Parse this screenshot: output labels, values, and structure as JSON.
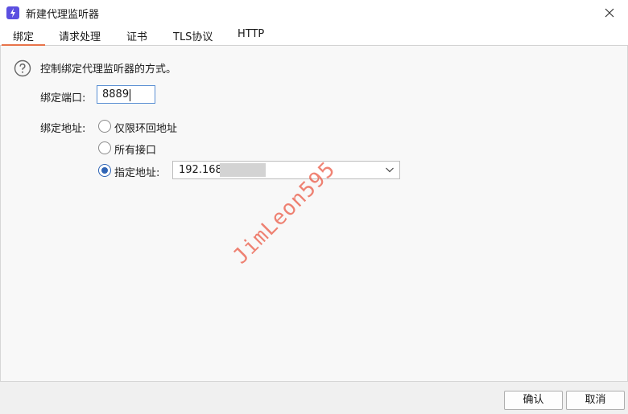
{
  "window": {
    "title": "新建代理监听器",
    "icon": "lightning-icon",
    "close_icon": "close-icon"
  },
  "tabs": [
    {
      "label": "绑定",
      "active": true
    },
    {
      "label": "请求处理",
      "active": false
    },
    {
      "label": "证书",
      "active": false
    },
    {
      "label": "TLS协议",
      "active": false
    },
    {
      "label": "HTTP",
      "active": false
    }
  ],
  "bind": {
    "description": "控制绑定代理监听器的方式。",
    "port_label": "绑定端口:",
    "port_value": "8889",
    "address_label": "绑定地址:",
    "options": [
      {
        "label": "仅限环回地址",
        "checked": false
      },
      {
        "label": "所有接口",
        "checked": false
      },
      {
        "label": "指定地址:",
        "checked": true
      }
    ],
    "address_value": "192.168"
  },
  "watermark": "JimLeon595",
  "buttons": {
    "ok": "确认",
    "cancel": "取消"
  },
  "colors": {
    "accent": "#e8734a",
    "radio": "#2f64b5",
    "icon": "#5b4fe0",
    "watermark": "#eb5a46"
  }
}
